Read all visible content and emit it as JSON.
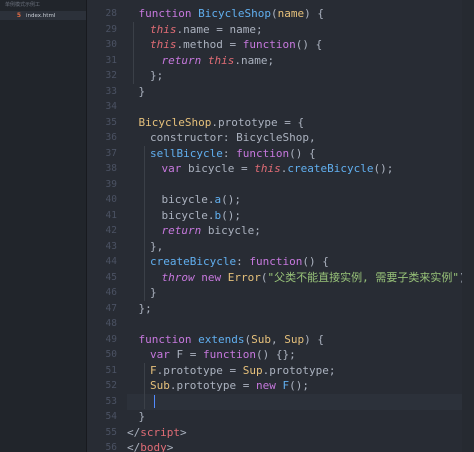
{
  "sidebar": {
    "title": "单例模式示例工",
    "files": [
      {
        "name": "index.html",
        "icon": "html-file-icon"
      }
    ]
  },
  "editor": {
    "line_numbers": [
      28,
      29,
      30,
      31,
      32,
      33,
      34,
      35,
      36,
      37,
      38,
      39,
      40,
      41,
      42,
      43,
      44,
      45,
      46,
      47,
      48,
      49,
      50,
      51,
      52,
      53,
      54,
      55,
      56
    ],
    "current_line": 53,
    "lines": [
      [
        [
          "k",
          "function "
        ],
        [
          "f",
          "BicycleShop"
        ],
        [
          "p",
          "("
        ],
        [
          "a",
          "name"
        ],
        [
          "p",
          ") {"
        ]
      ],
      [
        [
          "t",
          "this"
        ],
        [
          "p",
          ".name = name;"
        ]
      ],
      [
        [
          "t",
          "this"
        ],
        [
          "p",
          ".method = "
        ],
        [
          "k",
          "function"
        ],
        [
          "p",
          "() {"
        ]
      ],
      [
        [
          "r",
          "return "
        ],
        [
          "t",
          "this"
        ],
        [
          "p",
          ".name;"
        ]
      ],
      [
        [
          "p",
          "};"
        ]
      ],
      [
        [
          "p",
          "}"
        ]
      ],
      [],
      [
        [
          "y",
          "BicycleShop"
        ],
        [
          "p",
          ".prototype = {"
        ]
      ],
      [
        [
          "p",
          "constructor: BicycleShop,"
        ]
      ],
      [
        [
          "f",
          "sellBicycle"
        ],
        [
          "p",
          ": "
        ],
        [
          "k",
          "function"
        ],
        [
          "p",
          "() {"
        ]
      ],
      [
        [
          "k",
          "var "
        ],
        [
          "p",
          "bicycle = "
        ],
        [
          "t",
          "this"
        ],
        [
          "p",
          "."
        ],
        [
          "f",
          "createBicycle"
        ],
        [
          "p",
          "();"
        ]
      ],
      [],
      [
        [
          "p",
          "bicycle."
        ],
        [
          "f",
          "a"
        ],
        [
          "p",
          "();"
        ]
      ],
      [
        [
          "p",
          "bicycle."
        ],
        [
          "f",
          "b"
        ],
        [
          "p",
          "();"
        ]
      ],
      [
        [
          "r",
          "return "
        ],
        [
          "p",
          "bicycle;"
        ]
      ],
      [
        [
          "p",
          "},"
        ]
      ],
      [
        [
          "f",
          "createBicycle"
        ],
        [
          "p",
          ": "
        ],
        [
          "k",
          "function"
        ],
        [
          "p",
          "() {"
        ]
      ],
      [
        [
          "r",
          "throw "
        ],
        [
          "k",
          "new "
        ],
        [
          "y",
          "Error"
        ],
        [
          "p",
          "("
        ],
        [
          "s",
          "\"父类不能直接实例, 需要子类来实例\""
        ],
        [
          "p",
          ");"
        ]
      ],
      [
        [
          "p",
          "}"
        ]
      ],
      [
        [
          "p",
          "};"
        ]
      ],
      [],
      [
        [
          "k",
          "function "
        ],
        [
          "f",
          "extends"
        ],
        [
          "p",
          "("
        ],
        [
          "a",
          "Sub"
        ],
        [
          "p",
          ", "
        ],
        [
          "a",
          "Sup"
        ],
        [
          "p",
          ") {"
        ]
      ],
      [
        [
          "k",
          "var "
        ],
        [
          "p",
          "F = "
        ],
        [
          "k",
          "function"
        ],
        [
          "p",
          "() {};"
        ]
      ],
      [
        [
          "y",
          "F"
        ],
        [
          "p",
          ".prototype = "
        ],
        [
          "y",
          "Sup"
        ],
        [
          "p",
          ".prototype;"
        ]
      ],
      [
        [
          "y",
          "Sub"
        ],
        [
          "p",
          ".prototype = "
        ],
        [
          "k",
          "new "
        ],
        [
          "f",
          "F"
        ],
        [
          "p",
          "();"
        ]
      ],
      [],
      [
        [
          "p",
          "}"
        ]
      ],
      [
        [
          "p",
          "</"
        ],
        [
          "g",
          "script"
        ],
        [
          "p",
          ">"
        ]
      ],
      [
        [
          "p",
          "</"
        ],
        [
          "g",
          "body"
        ],
        [
          "p",
          ">"
        ]
      ]
    ]
  }
}
